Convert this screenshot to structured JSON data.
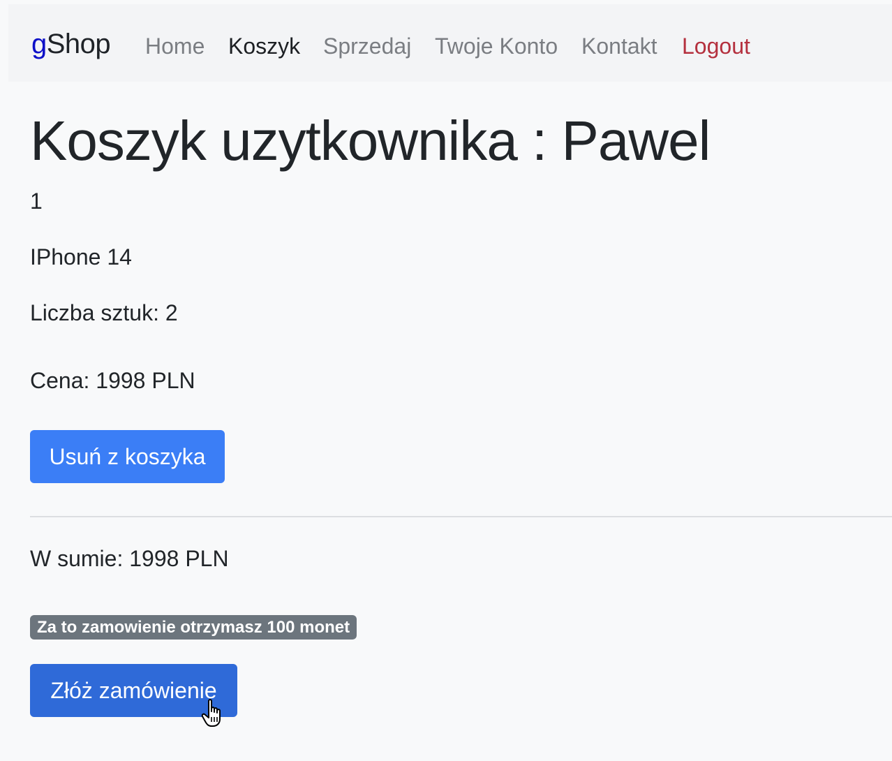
{
  "navbar": {
    "brand_first_letter": "g",
    "brand_rest": "Shop",
    "links": [
      {
        "label": "Home"
      },
      {
        "label": "Koszyk"
      },
      {
        "label": "Sprzedaj"
      },
      {
        "label": "Twoje Konto"
      },
      {
        "label": "Kontakt"
      },
      {
        "label": "Logout"
      }
    ]
  },
  "main": {
    "title": "Koszyk uzytkownika : Pawel",
    "item": {
      "index": "1",
      "name": "IPhone 14",
      "quantity_text": "Liczba sztuk: 2",
      "price_text": "Cena: 1998 PLN",
      "remove_label": "Usuń z koszyka"
    },
    "total_text": "W sumie: 1998 PLN",
    "coins_badge": "Za to zamowienie otrzymasz 100 monet",
    "order_label": "Złóż zamówienie"
  },
  "colors": {
    "brand_g": "#0d10c8",
    "logout": "#b4303e",
    "primary_button": "#3b7ef6",
    "order_button": "#2f6ad8",
    "badge": "#6c757d"
  },
  "icons": {
    "cursor": "hand-pointer-icon"
  }
}
